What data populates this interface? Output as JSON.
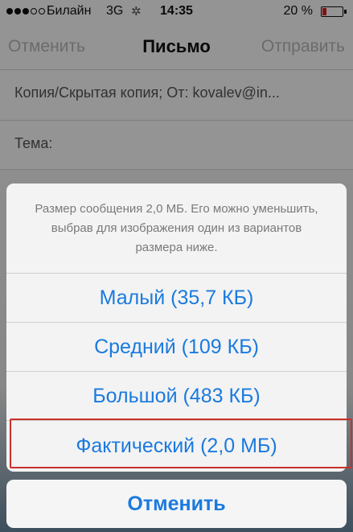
{
  "status_bar": {
    "carrier": "Билайн",
    "network": "3G",
    "time": "14:35",
    "battery_percent": "20 %",
    "battery_level": 0.2,
    "signal_bars_filled": 3,
    "signal_bars_total": 5,
    "activity_icon": "spinner-icon"
  },
  "nav": {
    "cancel_label": "Отменить",
    "title": "Письмо",
    "send_label": "Отправить"
  },
  "compose": {
    "cc_line": "Копия/Скрытая копия; От:  kovalev@in...",
    "subject_label": "Тема:"
  },
  "sheet": {
    "message": "Размер сообщения 2,0 МБ. Его можно уменьшить, выбрав для изображения один из вариантов размера ниже.",
    "options": [
      {
        "label": "Малый (35,7 КБ)"
      },
      {
        "label": "Средний (109 КБ)"
      },
      {
        "label": "Большой (483 КБ)"
      },
      {
        "label": "Фактический (2,0 МБ)"
      }
    ],
    "highlighted_option_index": 3,
    "cancel_label": "Отменить"
  },
  "colors": {
    "action_blue": "#1a7adf",
    "highlight_red": "#c9302c",
    "battery_red": "#e02020",
    "disabled_gray": "#b8b8b8"
  }
}
